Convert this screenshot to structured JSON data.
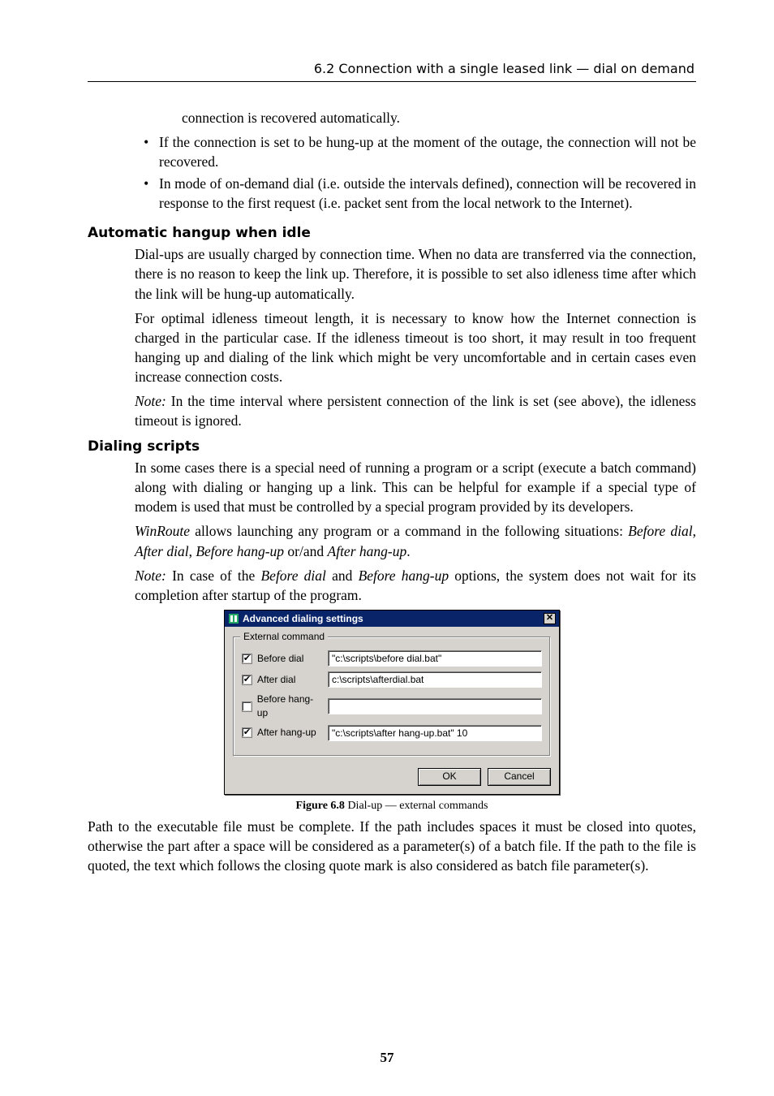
{
  "header": {
    "running_title": "6.2  Connection with a single leased link — dial on demand"
  },
  "intro_line": "connection is recovered automatically.",
  "bullets": [
    "If the connection is set to be hung-up at the moment of the outage, the connection will not be recovered.",
    "In mode of on-demand dial (i.e.  outside the intervals defined), connection will be recovered in response to the first request (i.e.  packet sent from the local network to the Internet)."
  ],
  "sections": {
    "auto_hangup": {
      "title": "Automatic hangup when idle",
      "p1": "Dial-ups are usually charged by connection time.  When no data are transferred via the connection, there is no reason to keep the link up.  Therefore, it is possible to set also idleness time after which the link will be hung-up automatically.",
      "p2": "For optimal idleness timeout length, it is necessary to know how the Internet connection is charged in the particular case. If the idleness timeout is too short, it may result in too frequent hanging up and dialing of the link which might be very uncomfortable and in certain cases even increase connection costs.",
      "p3_prefix": "Note:",
      "p3_rest": " In the time interval where persistent connection of the link is set (see above), the idleness timeout is ignored."
    },
    "dialing_scripts": {
      "title": "Dialing scripts",
      "p1": "In some cases there is a special need of running a program or a script (execute a batch command) along with dialing or hanging up a link.  This can be helpful for example if a special type of modem is used that must be controlled by a special program provided by its developers.",
      "p2_a": "WinRoute",
      "p2_b": " allows launching any program or a command in the following situations: ",
      "p2_c": "Before dial",
      "p2_d": ", ",
      "p2_e": "After dial",
      "p2_f": ", ",
      "p2_g": "Before hang-up",
      "p2_h": " or/and ",
      "p2_i": "After hang-up",
      "p2_j": ".",
      "p3_a": "Note:",
      "p3_b": " In case of the ",
      "p3_c": "Before dial",
      "p3_d": " and ",
      "p3_e": "Before hang-up",
      "p3_f": " options, the system does not wait for its completion after startup of the program."
    }
  },
  "dialog": {
    "title": "Advanced dialing settings",
    "close_glyph": "✕",
    "group_legend": "External command",
    "rows": {
      "before_dial": {
        "checked": true,
        "label": "Before dial",
        "value": "\"c:\\scripts\\before dial.bat\""
      },
      "after_dial": {
        "checked": true,
        "label": "After dial",
        "value": "c:\\scripts\\afterdial.bat"
      },
      "before_hangup": {
        "checked": false,
        "label": "Before hang-up",
        "value": ""
      },
      "after_hangup": {
        "checked": true,
        "label": "After hang-up",
        "value": "\"c:\\scripts\\after hang-up.bat\" 10"
      }
    },
    "buttons": {
      "ok": "OK",
      "cancel": "Cancel"
    }
  },
  "figure": {
    "label": "Figure 6.8",
    "caption": "   Dial-up — external commands"
  },
  "tail_para": "Path to the executable file must be complete.  If the path includes spaces it must be closed into quotes, otherwise the part after a space will be considered as a parameter(s) of a batch file.  If the path to the file is quoted, the text which follows the closing quote mark is also considered as batch file parameter(s).",
  "page_number": "57",
  "glyphs": {
    "check": "✔"
  }
}
